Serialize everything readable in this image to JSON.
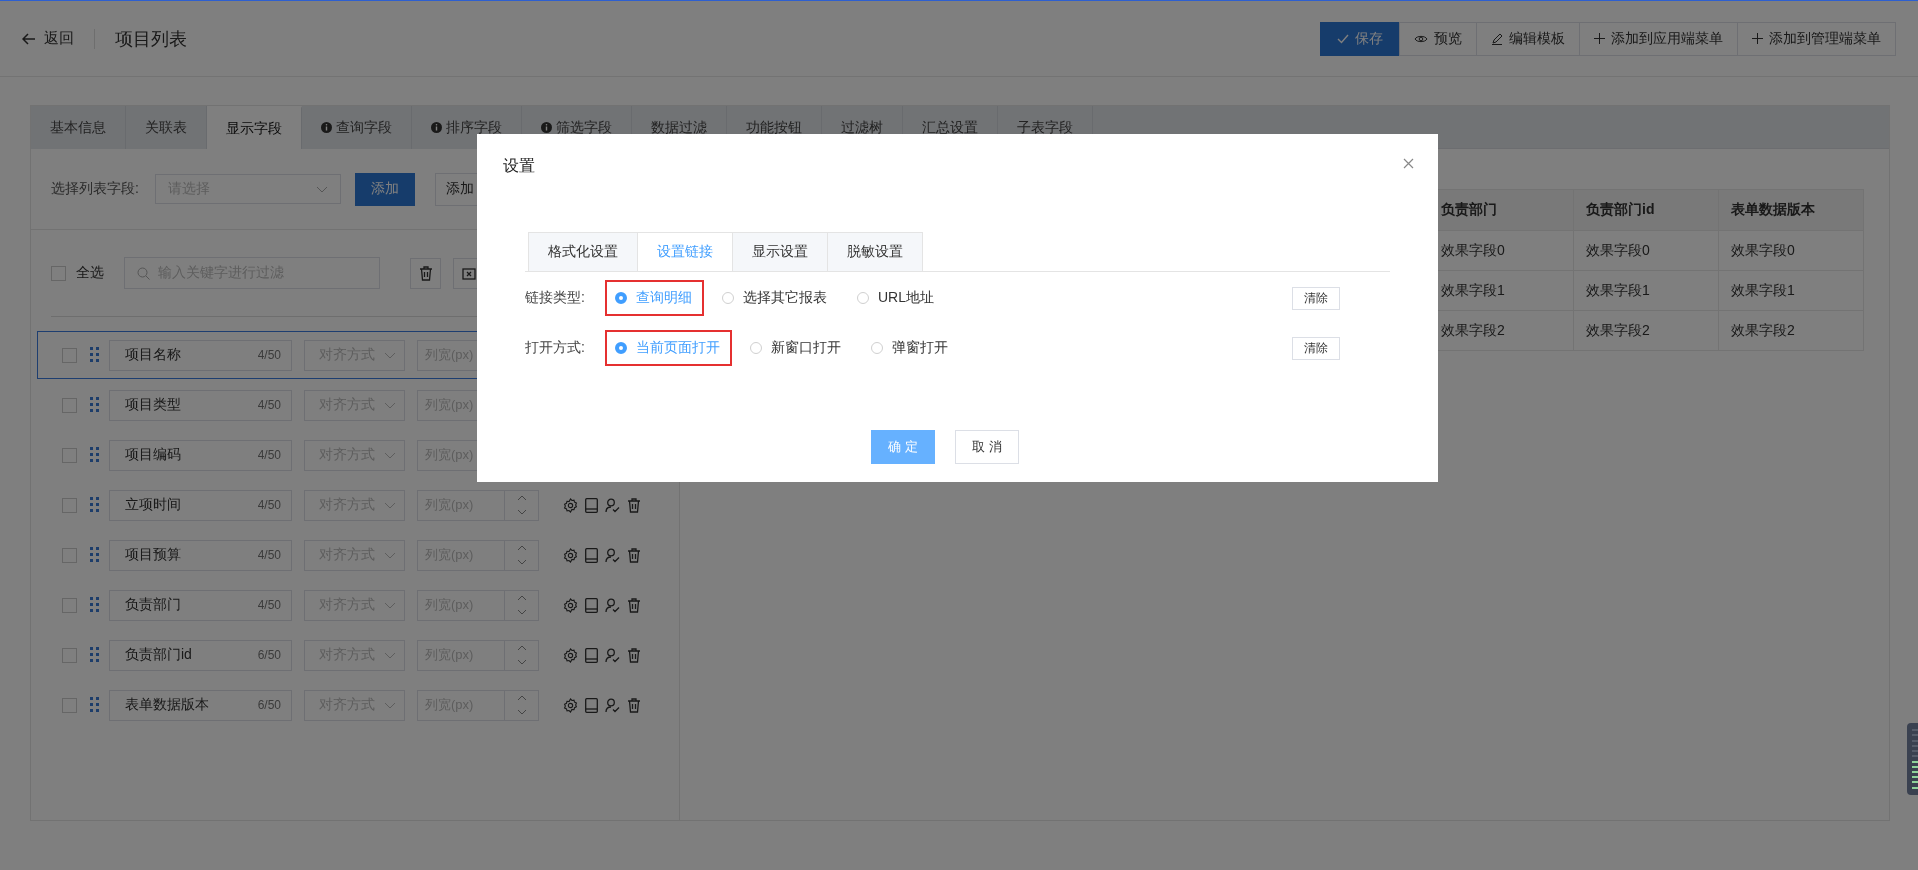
{
  "header": {
    "back_label": "返回",
    "title": "项目列表",
    "actions": [
      {
        "label": "保存",
        "kind": "save"
      },
      {
        "label": "预览",
        "kind": "preview"
      },
      {
        "label": "编辑模板",
        "kind": "edit"
      },
      {
        "label": "添加到应用端菜单",
        "kind": "add"
      },
      {
        "label": "添加到管理端菜单",
        "kind": "add"
      }
    ]
  },
  "tabs": [
    {
      "label": "基本信息",
      "selected": false,
      "info": false
    },
    {
      "label": "关联表",
      "selected": false,
      "info": false
    },
    {
      "label": "显示字段",
      "selected": true,
      "info": false
    },
    {
      "label": "查询字段",
      "selected": false,
      "info": true
    },
    {
      "label": "排序字段",
      "selected": false,
      "info": true
    },
    {
      "label": "筛选字段",
      "selected": false,
      "info": true
    },
    {
      "label": "数据过滤",
      "selected": false,
      "info": false
    },
    {
      "label": "功能按钮",
      "selected": false,
      "info": false
    },
    {
      "label": "过滤树",
      "selected": false,
      "info": false
    },
    {
      "label": "汇总设置",
      "selected": false,
      "info": false
    },
    {
      "label": "子表字段",
      "selected": false,
      "info": false
    }
  ],
  "field_picker": {
    "label": "选择列表字段:",
    "placeholder": "请选择",
    "add_button": "添加",
    "second_button": "添加"
  },
  "filter": {
    "select_all_label": "全选",
    "select_all_checked": false,
    "search_placeholder": "输入关键字进行过滤"
  },
  "rows": [
    {
      "name": "项目名称",
      "count": "4/50",
      "align_placeholder": "对齐方式",
      "width_placeholder": "列宽(px)",
      "checked": false,
      "selected": true
    },
    {
      "name": "项目类型",
      "count": "4/50",
      "align_placeholder": "对齐方式",
      "width_placeholder": "列宽(px)",
      "checked": false,
      "selected": false
    },
    {
      "name": "项目编码",
      "count": "4/50",
      "align_placeholder": "对齐方式",
      "width_placeholder": "列宽(px)",
      "checked": false,
      "selected": false
    },
    {
      "name": "立项时间",
      "count": "4/50",
      "align_placeholder": "对齐方式",
      "width_placeholder": "列宽(px)",
      "checked": false,
      "selected": false
    },
    {
      "name": "项目预算",
      "count": "4/50",
      "align_placeholder": "对齐方式",
      "width_placeholder": "列宽(px)",
      "checked": false,
      "selected": false
    },
    {
      "name": "负责部门",
      "count": "4/50",
      "align_placeholder": "对齐方式",
      "width_placeholder": "列宽(px)",
      "checked": false,
      "selected": false
    },
    {
      "name": "负责部门id",
      "count": "6/50",
      "align_placeholder": "对齐方式",
      "width_placeholder": "列宽(px)",
      "checked": false,
      "selected": false
    },
    {
      "name": "表单数据版本",
      "count": "6/50",
      "align_placeholder": "对齐方式",
      "width_placeholder": "列宽(px)",
      "checked": false,
      "selected": false
    }
  ],
  "preview_table": {
    "columns": [
      "负责部门",
      "负责部门id",
      "表单数据版本"
    ],
    "rows": [
      [
        "效果字段0",
        "效果字段0",
        "效果字段0"
      ],
      [
        "效果字段1",
        "效果字段1",
        "效果字段1"
      ],
      [
        "效果字段2",
        "效果字段2",
        "效果字段2"
      ]
    ]
  },
  "dialog": {
    "title": "设置",
    "tabs": [
      {
        "label": "格式化设置",
        "selected": false
      },
      {
        "label": "设置链接",
        "selected": true
      },
      {
        "label": "显示设置",
        "selected": false
      },
      {
        "label": "脱敏设置",
        "selected": false
      }
    ],
    "fields": [
      {
        "label": "链接类型:",
        "clear_label": "清除",
        "options": [
          {
            "label": "查询明细",
            "selected": true,
            "annotated": true
          },
          {
            "label": "选择其它报表",
            "selected": false,
            "annotated": false
          },
          {
            "label": "URL地址",
            "selected": false,
            "annotated": false
          }
        ]
      },
      {
        "label": "打开方式:",
        "clear_label": "清除",
        "options": [
          {
            "label": "当前页面打开",
            "selected": true,
            "annotated": true
          },
          {
            "label": "新窗口打开",
            "selected": false,
            "annotated": false
          },
          {
            "label": "弹窗打开",
            "selected": false,
            "annotated": false
          }
        ]
      }
    ],
    "confirm_label": "确 定",
    "cancel_label": "取 消"
  }
}
